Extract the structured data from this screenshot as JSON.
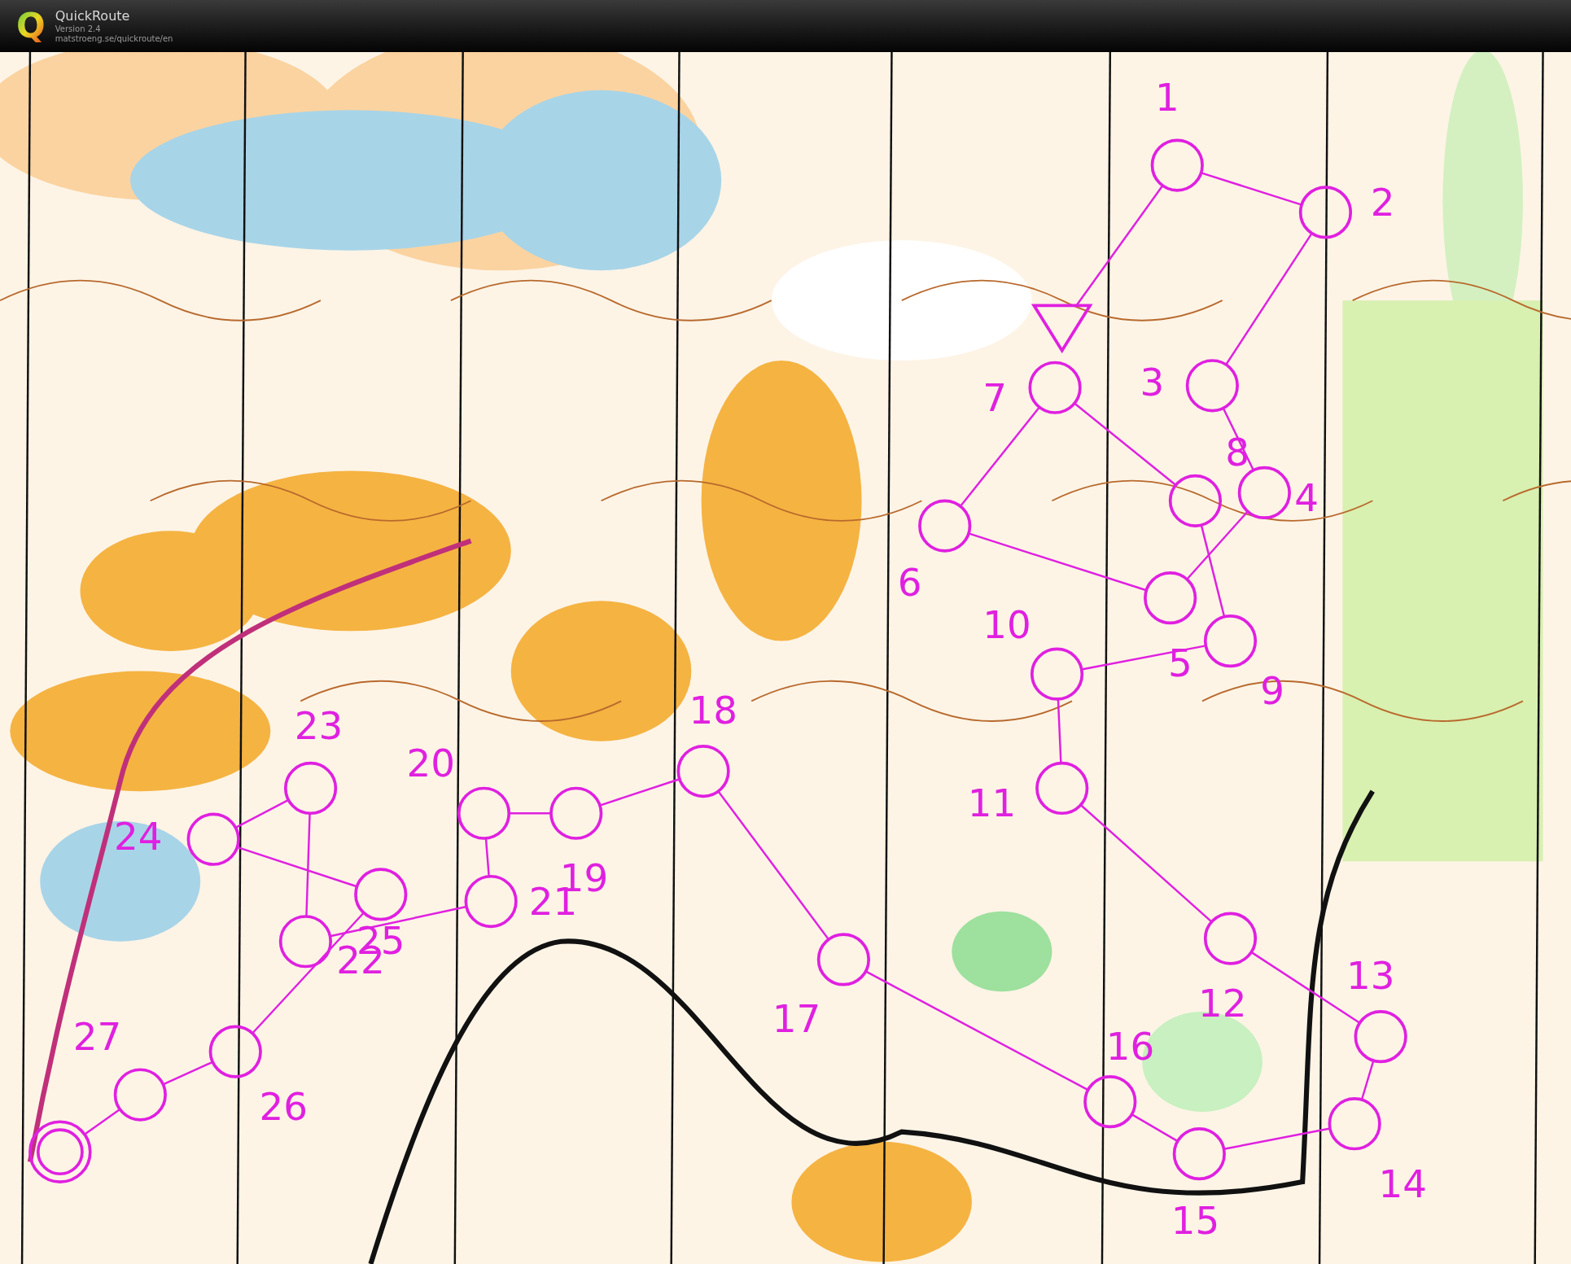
{
  "header": {
    "logo_letter": "Q",
    "app_name": "QuickRoute",
    "version": "Version 2.4",
    "url": "matstroeng.se/quickroute/en"
  },
  "course": {
    "controls": [
      {
        "number": "1"
      },
      {
        "number": "2"
      },
      {
        "number": "3"
      },
      {
        "number": "4"
      },
      {
        "number": "5"
      },
      {
        "number": "6"
      },
      {
        "number": "7"
      },
      {
        "number": "8"
      },
      {
        "number": "9"
      },
      {
        "number": "10"
      },
      {
        "number": "11"
      },
      {
        "number": "12"
      },
      {
        "number": "13"
      },
      {
        "number": "14"
      },
      {
        "number": "15"
      },
      {
        "number": "16"
      },
      {
        "number": "17"
      },
      {
        "number": "18"
      },
      {
        "number": "19"
      },
      {
        "number": "20"
      },
      {
        "number": "21"
      },
      {
        "number": "22"
      },
      {
        "number": "23"
      },
      {
        "number": "24"
      },
      {
        "number": "25"
      },
      {
        "number": "26"
      },
      {
        "number": "27"
      }
    ]
  }
}
